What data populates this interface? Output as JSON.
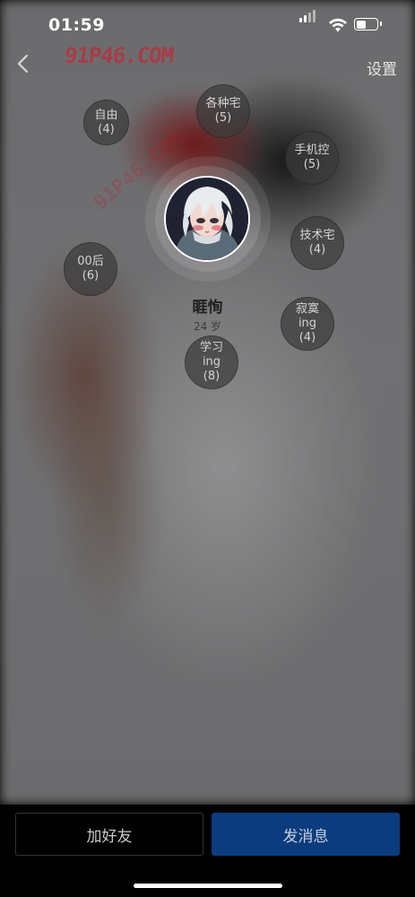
{
  "status_bar": {
    "time": "01:59",
    "battery_level": 0.55
  },
  "nav": {
    "settings_label": "设置",
    "watermark": "91P46.COM"
  },
  "profile": {
    "name": "睚恂",
    "age": "24 岁"
  },
  "tags": [
    {
      "line1": "自由",
      "line2": "(4)"
    },
    {
      "line1": "各种宅",
      "line2": "(5)"
    },
    {
      "line1": "手机控",
      "line2": "(5)"
    },
    {
      "line1": "技术宅",
      "line2": "(4)"
    },
    {
      "line1": "00后",
      "line2": "(6)"
    },
    {
      "line1": "寂寞",
      "line2": "ing",
      "line3": "(4)"
    },
    {
      "line1": "学习",
      "line2": "ing",
      "line3": "(8)"
    }
  ],
  "actions": {
    "add_friend": "加好友",
    "send_message": "发消息"
  },
  "colors": {
    "primary_button": "#0b3c7e",
    "watermark": "#dc1428"
  }
}
